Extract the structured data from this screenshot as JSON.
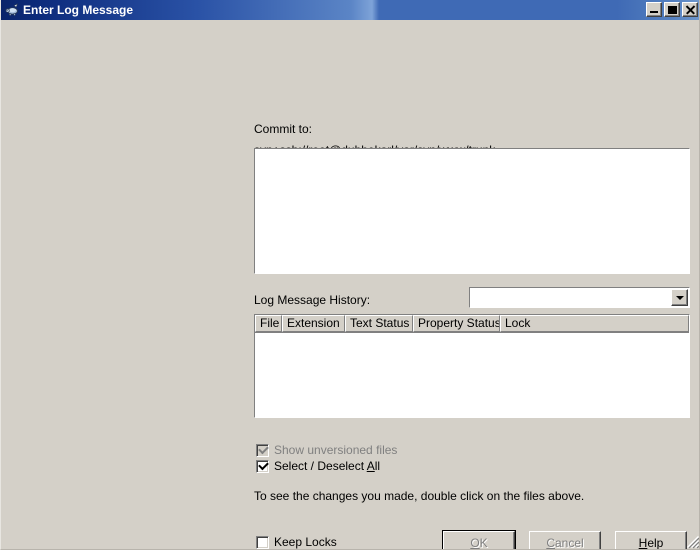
{
  "window": {
    "title": "Enter Log Message",
    "icon": "tortoise-svn-icon",
    "background_color": "#d4d0c8",
    "titlebar_color_start": "#0a246a",
    "titlebar_color_end": "#6f98cd",
    "controls": [
      {
        "name": "minimize",
        "label": "_"
      },
      {
        "name": "maximize",
        "label": "□"
      },
      {
        "name": "close",
        "label": "×"
      }
    ]
  },
  "commit": {
    "label": "Commit to:",
    "url": "svn+ssh://root@dubbekarl/var/svn/www/trunk"
  },
  "log_message": {
    "value": "",
    "placeholder": ""
  },
  "history": {
    "label": "Log Message History:",
    "selected": "",
    "options": []
  },
  "file_list": {
    "columns": [
      "File",
      "Extension",
      "Text Status",
      "Property Status",
      "Lock"
    ],
    "rows": []
  },
  "options": {
    "show_unversioned": {
      "label": "Show unversioned files",
      "checked": true,
      "enabled": false
    },
    "select_all": {
      "label": "Select / Deselect All",
      "label_pre": "Select / Deselect ",
      "label_accel": "A",
      "label_post": "ll",
      "checked": true,
      "enabled": true
    },
    "keep_locks": {
      "label": "Keep Locks",
      "checked": false,
      "enabled": true
    }
  },
  "hint": "To see the changes you made, double click on the files above.",
  "buttons": {
    "ok": {
      "label": "OK",
      "accel": "O",
      "pre": "",
      "post": "K",
      "enabled": false,
      "default": true
    },
    "cancel": {
      "label": "Cancel",
      "accel": "C",
      "pre": "",
      "post": "ancel",
      "enabled": false,
      "default": false
    },
    "help": {
      "label": "Help",
      "accel": "H",
      "pre": "",
      "post": "elp",
      "enabled": true,
      "default": false
    }
  }
}
